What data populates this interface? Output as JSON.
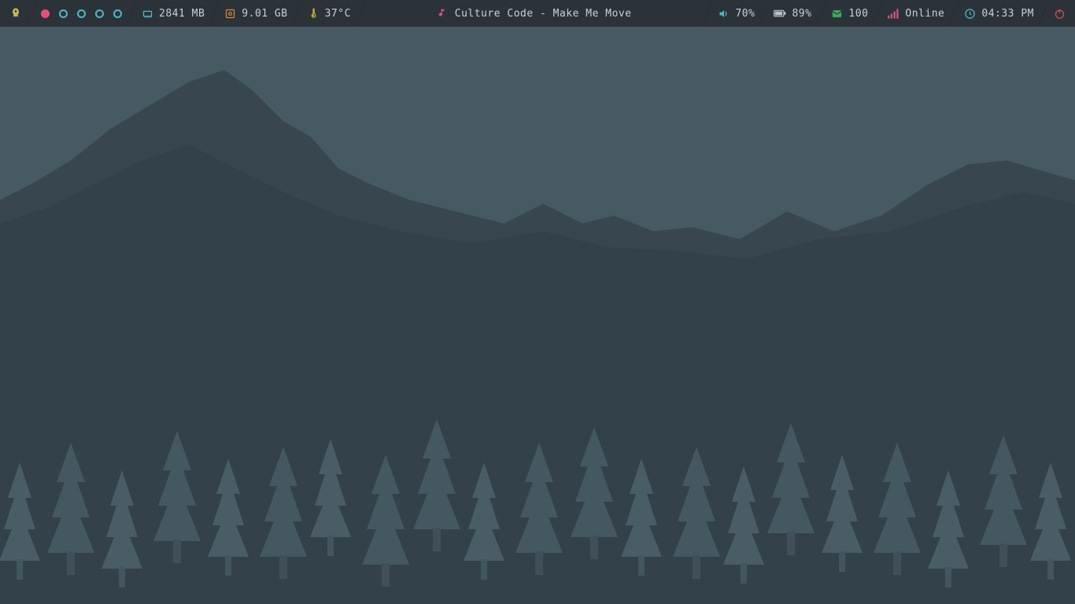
{
  "bar": {
    "memory": "2841 MB",
    "disk": "9.01 GB",
    "temp": "37°C",
    "music": "Culture Code - Make Me Move",
    "volume": "70%",
    "battery": "89%",
    "mail": "100",
    "network": "Online",
    "clock": "04:33 PM"
  },
  "workspaces": {
    "count": 5,
    "active": 0
  },
  "colors": {
    "launcher": "#c9b95a",
    "memory": "#4fb8c8",
    "disk": "#d6883e",
    "temp": "#d6b23e",
    "music": "#d15a77",
    "volume": "#4fb8c8",
    "battery": "#b9c2c6",
    "mail": "#3fae60",
    "network": "#d15a77",
    "clock": "#4fb8c8",
    "power": "#d64d4d"
  }
}
